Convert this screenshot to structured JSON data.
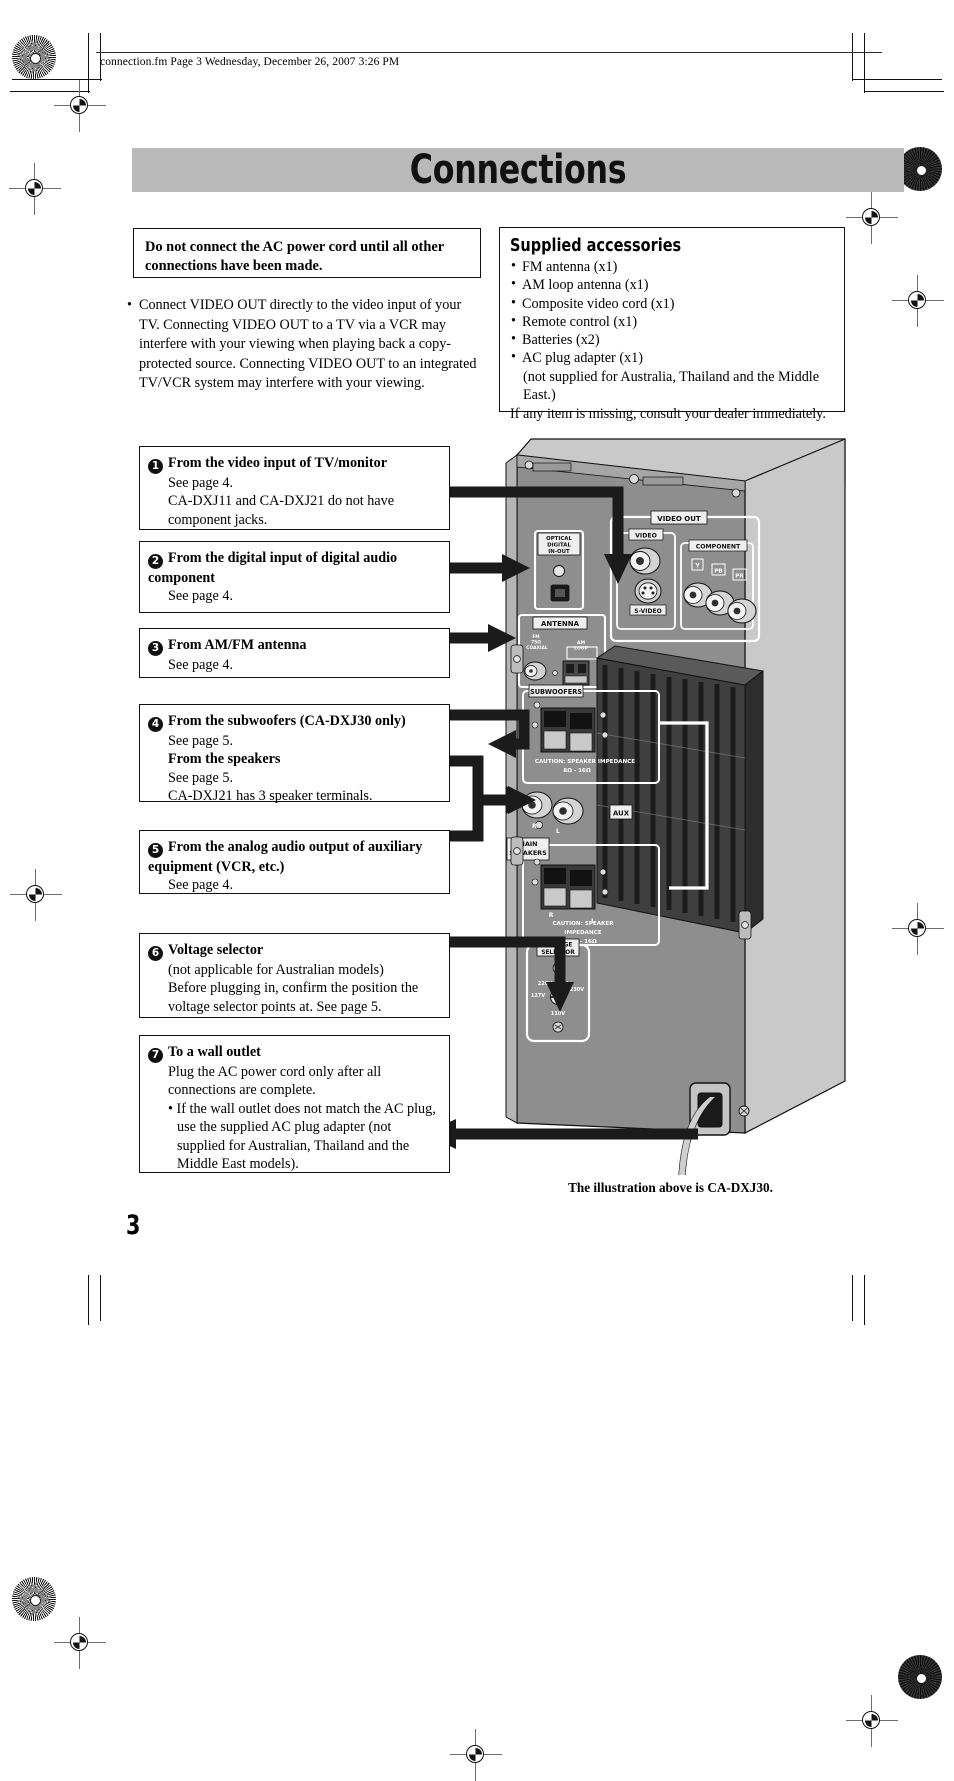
{
  "page": {
    "header_text": "connection.fm  Page 3  Wednesday, December 26, 2007  3:26 PM",
    "title": "Connections",
    "page_number": "3",
    "caption": "The illustration above is CA-DXJ30.",
    "banner_color": "#b9b9b9"
  },
  "warning": {
    "text": "Do not connect the AC power cord until all other connections have been made."
  },
  "note": {
    "bullet": "•",
    "text": "Connect VIDEO OUT directly to the video input of your TV. Connecting VIDEO OUT to a TV via a VCR may interfere with your viewing when playing back a copy-protected source. Connecting VIDEO OUT to an integrated TV/VCR system may interfere with your viewing."
  },
  "accessories": {
    "title": "Supplied accessories",
    "bullet": "•",
    "items": [
      "FM antenna (x1)",
      "AM loop antenna (x1)",
      "Composite video cord (x1)",
      "Remote control (x1)",
      "Batteries (x2)",
      "AC plug adapter (x1)"
    ],
    "continuation": "(not supplied for Australia, Thailand and the Middle East.)",
    "footer": "If any item is missing, consult your dealer immediately."
  },
  "callouts": [
    {
      "number": "1",
      "heading": "From the video input of TV/monitor",
      "lines": [
        "See page 4.",
        "CA-DXJ11 and CA-DXJ21 do not have component jacks."
      ]
    },
    {
      "number": "2",
      "heading": "From the digital input of digital audio component",
      "lines": [
        "See page 4."
      ]
    },
    {
      "number": "3",
      "heading": "From AM/FM antenna",
      "lines": [
        "See page 4."
      ]
    },
    {
      "number": "4",
      "heading": "From the subwoofers (CA-DXJ30 only)",
      "lines": [
        "See page 5."
      ],
      "subheading": "From the speakers",
      "lines2": [
        "See page 5.",
        "CA-DXJ21 has 3 speaker terminals."
      ]
    },
    {
      "number": "5",
      "heading": "From the analog audio output of auxiliary equipment (VCR, etc.)",
      "lines": [
        "See page 4."
      ]
    },
    {
      "number": "6",
      "heading": "Voltage selector",
      "lines": [
        "(not applicable for Australian models)",
        "Before plugging in, confirm the position the voltage selector points at. See page 5."
      ]
    },
    {
      "number": "7",
      "heading": "To a wall outlet",
      "lines": [
        "Plug the AC power cord only after all connections are complete."
      ],
      "bullets": [
        "If the wall outlet does not match the AC plug, use the supplied AC plug adapter (not supplied for Australian, Thailand and the Middle East models)."
      ]
    }
  ],
  "illustration": {
    "labels": {
      "optical": "OPTICAL DIGITAL IN-OUT",
      "antenna": "ANTENNA",
      "antenna_fm": "FM 75Ω COAXIAL",
      "antenna_am": "AM LOOP",
      "video_out": "VIDEO OUT",
      "video": "VIDEO",
      "s_video": "S-VIDEO",
      "component": "COMPONENT",
      "component_y": "Y",
      "component_pb": "PB",
      "component_pr": "PR",
      "subwoofers": "SUBWOOFERS",
      "main_speakers": "MAIN SPEAKERS",
      "aux": "AUX",
      "aux_r": "R",
      "aux_l": "L",
      "caution": "CAUTION: SPEAKER IMPEDANCE 8Ω - 16Ω",
      "voltage_selector": "VOLTAGE SELECTOR",
      "v_110": "110V",
      "v_127": "127V",
      "v_220_240": "220V-240V",
      "v_230": "230V"
    },
    "colors": {
      "cabinet_top": "#c9c9c9",
      "cabinet_side": "#c9c9c9",
      "rear_panel": "#8e8e8e",
      "heatsink": "#4a4a4a",
      "heatsink_dark": "#2d2d2d",
      "jack_light": "#e8e8e8"
    }
  }
}
